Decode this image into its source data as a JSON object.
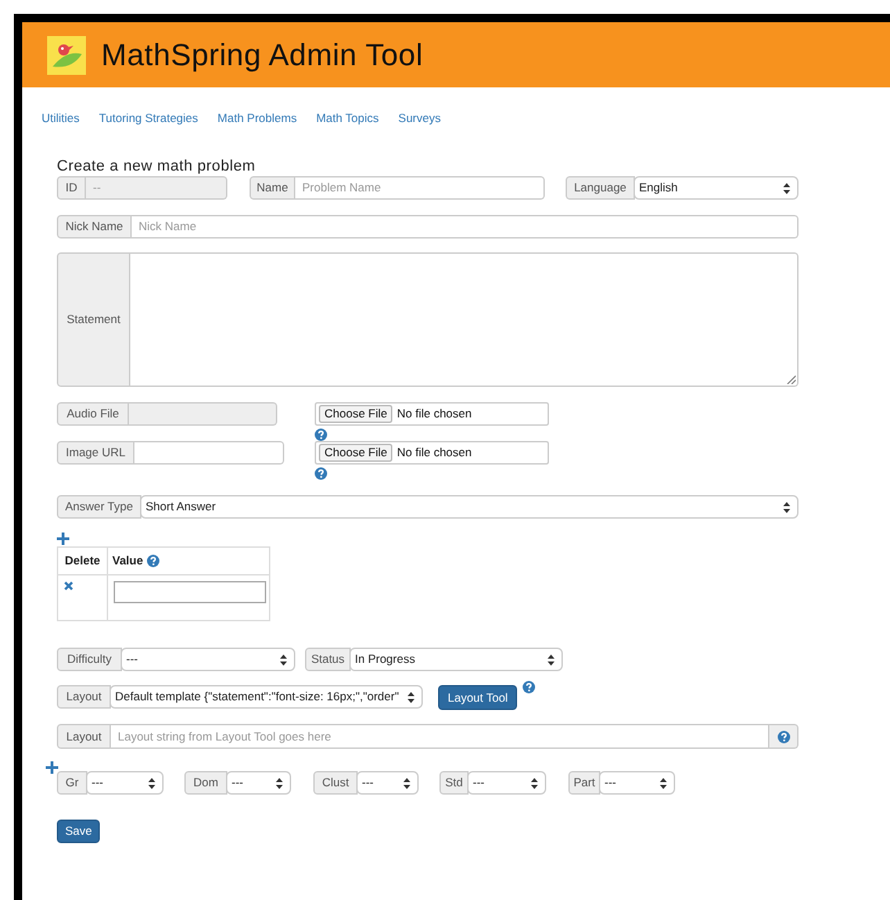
{
  "header": {
    "title": "MathSpring Admin Tool"
  },
  "nav": [
    {
      "label": "Utilities"
    },
    {
      "label": "Tutoring Strategies"
    },
    {
      "label": "Math Problems"
    },
    {
      "label": "Math Topics"
    },
    {
      "label": "Surveys"
    }
  ],
  "form": {
    "title": "Create a new math problem",
    "id": {
      "label": "ID",
      "value": "--",
      "disabled": true
    },
    "name": {
      "label": "Name",
      "placeholder": "Problem Name"
    },
    "language": {
      "label": "Language",
      "value": "English"
    },
    "nick_name": {
      "label": "Nick Name",
      "placeholder": "Nick Name"
    },
    "statement": {
      "label": "Statement"
    },
    "audio_file": {
      "label": "Audio File",
      "disabled": true,
      "choose_button": "Choose File",
      "file_status": "No file chosen"
    },
    "image_url": {
      "label": "Image URL",
      "disabled": false,
      "choose_button": "Choose File",
      "file_status": "No file chosen"
    },
    "answer_type": {
      "label": "Answer Type",
      "value": "Short Answer"
    },
    "answers_table": {
      "columns": [
        "Delete",
        "Value"
      ]
    },
    "difficulty": {
      "label": "Difficulty",
      "value": "---"
    },
    "status": {
      "label": "Status",
      "value": "In Progress"
    },
    "layout_select": {
      "label": "Layout",
      "value": "Default template {\"statement\":\"font-size: 16px;\",\"order\""
    },
    "layout_tool_button": "Layout Tool",
    "layout_string": {
      "label": "Layout",
      "placeholder": "Layout string from Layout Tool goes here"
    },
    "standards": [
      {
        "label": "Gr",
        "value": "---"
      },
      {
        "label": "Dom",
        "value": "---"
      },
      {
        "label": "Clust",
        "value": "---"
      },
      {
        "label": "Std",
        "value": "---"
      },
      {
        "label": "Part",
        "value": "---"
      }
    ],
    "save_button": "Save"
  }
}
